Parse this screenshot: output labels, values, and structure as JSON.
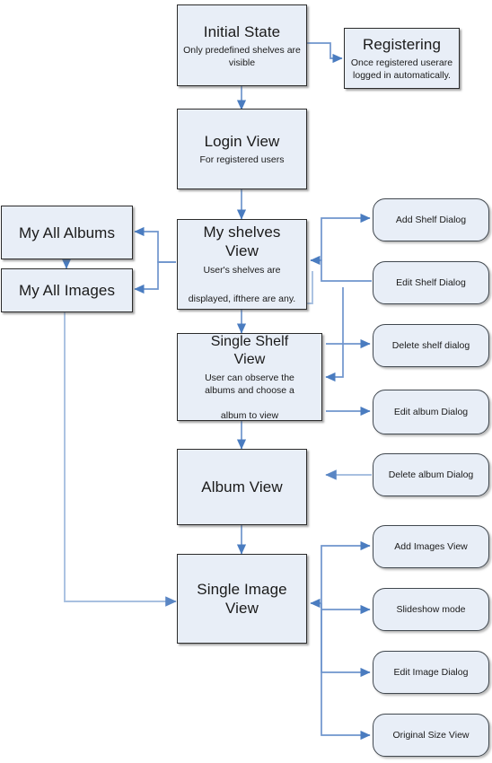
{
  "diagram": {
    "title": "Photo Album Application Navigation Flow",
    "colors": {
      "node_fill": "#e8eef7",
      "rect_border": "#2b2b2b",
      "round_border": "#41484f",
      "connector": "#6f95cd",
      "connector_light": "#a8c0e0",
      "background": "#ffffff",
      "text": "#1a1a1a"
    },
    "nodes": [
      {
        "id": "initial-state",
        "shape": "rect",
        "title": "Initial State",
        "subtitle": "Only predefined shelves are\nvisible"
      },
      {
        "id": "registering",
        "shape": "rect",
        "title": "Registering",
        "subtitle": "Once  registered userare\nlogged in automatically."
      },
      {
        "id": "login-view",
        "shape": "rect",
        "title": "Login View",
        "subtitle": "For registered users"
      },
      {
        "id": "my-all-albums",
        "shape": "rect",
        "title": "My All Albums",
        "subtitle": ""
      },
      {
        "id": "my-all-images",
        "shape": "rect",
        "title": "My All Images",
        "subtitle": ""
      },
      {
        "id": "my-shelves-view",
        "shape": "rect",
        "title": "My shelves\nView",
        "subtitle": "User's shelves are\n\ndisplayed, ifthere are any."
      },
      {
        "id": "single-shelf-view",
        "shape": "rect",
        "title": "Single Shelf\nView",
        "subtitle": "User can observe the\nalbums and choose a\n\nalbum to view"
      },
      {
        "id": "album-view",
        "shape": "rect",
        "title": "Album View",
        "subtitle": ""
      },
      {
        "id": "single-image-view",
        "shape": "rect",
        "title": "Single Image\nView",
        "subtitle": ""
      },
      {
        "id": "add-shelf-dialog",
        "shape": "round",
        "title": "Add Shelf Dialog"
      },
      {
        "id": "edit-shelf-dialog",
        "shape": "round",
        "title": "Edit Shelf Dialog"
      },
      {
        "id": "delete-shelf-dialog",
        "shape": "round",
        "title": "Delete shelf dialog"
      },
      {
        "id": "edit-album-dialog",
        "shape": "round",
        "title": "Edit album Dialog"
      },
      {
        "id": "delete-album-dialog",
        "shape": "round",
        "title": "Delete album Dialog"
      },
      {
        "id": "add-images-view",
        "shape": "round",
        "title": "Add Images View"
      },
      {
        "id": "slideshow-mode",
        "shape": "round",
        "title": "Slideshow mode"
      },
      {
        "id": "edit-image-dialog",
        "shape": "round",
        "title": "Edit Image Dialog"
      },
      {
        "id": "original-size-view",
        "shape": "round",
        "title": "Original Size View"
      }
    ],
    "edges": [
      {
        "from": "initial-state",
        "to": "registering",
        "label": ""
      },
      {
        "from": "initial-state",
        "to": "login-view",
        "label": ""
      },
      {
        "from": "login-view",
        "to": "my-shelves-view",
        "label": ""
      },
      {
        "from": "my-shelves-view",
        "to": "my-all-albums",
        "label": ""
      },
      {
        "from": "my-shelves-view",
        "to": "my-all-images",
        "label": ""
      },
      {
        "from": "my-all-albums",
        "to": "my-all-images",
        "label": ""
      },
      {
        "from": "my-shelves-view",
        "to": "add-shelf-dialog",
        "label": ""
      },
      {
        "from": "my-shelves-view",
        "to": "edit-shelf-dialog",
        "label": ""
      },
      {
        "from": "edit-shelf-dialog",
        "to": "my-shelves-view",
        "label": ""
      },
      {
        "from": "my-shelves-view",
        "to": "single-shelf-view",
        "label": ""
      },
      {
        "from": "single-shelf-view",
        "to": "delete-shelf-dialog",
        "label": ""
      },
      {
        "from": "single-shelf-view",
        "to": "album-view",
        "label": ""
      },
      {
        "from": "album-view",
        "to": "edit-album-dialog",
        "label": ""
      },
      {
        "from": "album-view",
        "to": "delete-album-dialog",
        "label": ""
      },
      {
        "from": "album-view",
        "to": "single-image-view",
        "label": ""
      },
      {
        "from": "my-all-images",
        "to": "single-image-view",
        "label": ""
      },
      {
        "from": "single-image-view",
        "to": "add-images-view",
        "label": ""
      },
      {
        "from": "single-image-view",
        "to": "slideshow-mode",
        "label": ""
      },
      {
        "from": "single-image-view",
        "to": "edit-image-dialog",
        "label": ""
      },
      {
        "from": "single-image-view",
        "to": "original-size-view",
        "label": ""
      }
    ]
  }
}
